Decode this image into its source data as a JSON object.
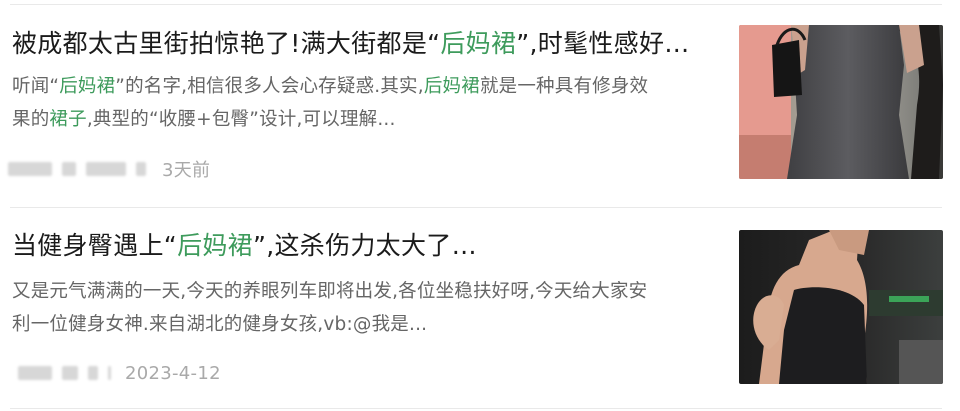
{
  "feed": {
    "items": [
      {
        "title_parts": [
          "被成都太古里街拍惊艳了!满大街都是“",
          "后妈裙",
          "”,时髦性感好…"
        ],
        "summary_line1_parts": [
          "听闻“",
          "后妈裙",
          "”的名字,相信很多人会心存疑惑.其实,",
          "后妈裙",
          "就是一种具有修身效"
        ],
        "summary_line2_parts": [
          "果的",
          "裙子",
          ",典型的“收腰+包臀”设计,可以理解..."
        ],
        "date": "3天前",
        "thumbnail_icon": "photo-thumbnail"
      },
      {
        "title_parts": [
          "当健身臀遇上“",
          "后妈裙",
          "”,这杀伤力太大了…"
        ],
        "summary_line1": "又是元气满满的一天,今天的养眼列车即将出发,各位坐稳扶好呀,今天给大家安",
        "summary_line2": "利一位健身女神.来自湖北的健身女孩,vb:@我是...",
        "date": "2023-4-12",
        "thumbnail_icon": "photo-thumbnail"
      }
    ]
  },
  "colors": {
    "highlight": "#3e9b5c",
    "title": "#1b1b1b",
    "summary": "#666666",
    "meta": "#a9a9a9",
    "divider": "#e9e9e9"
  }
}
